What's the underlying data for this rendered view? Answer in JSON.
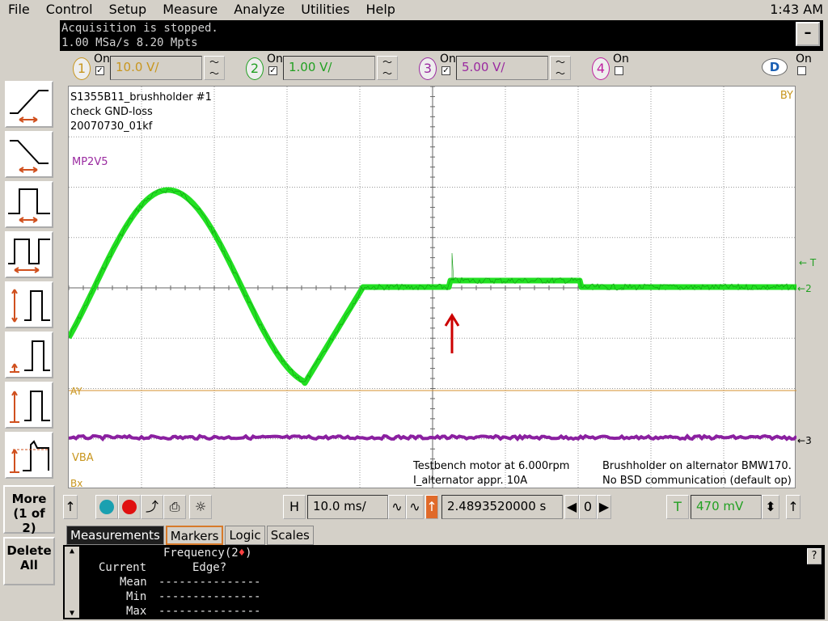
{
  "menu": [
    "File",
    "Control",
    "Setup",
    "Measure",
    "Analyze",
    "Utilities",
    "Help"
  ],
  "clock": "1:43 AM",
  "status": {
    "line1": "Acquisition is stopped.",
    "line2": "1.00 MSa/s   8.20 Mpts"
  },
  "channels": [
    {
      "num": "1",
      "on": "On",
      "checked": true,
      "scale": "10.0 V/",
      "color": "#c8961e",
      "ring": "#c8961e"
    },
    {
      "num": "2",
      "on": "On",
      "checked": true,
      "scale": "1.00 V/",
      "color": "#22a022",
      "ring": "#22a022"
    },
    {
      "num": "3",
      "on": "On",
      "checked": true,
      "scale": "5.00 V/",
      "color": "#9a2aa0",
      "ring": "#9a2aa0"
    },
    {
      "num": "4",
      "on": "On",
      "checked": false,
      "scale": "",
      "color": "#c020a0",
      "ring": "#c020a0"
    },
    {
      "num": "D",
      "on": "On",
      "checked": false,
      "scale": "",
      "color": "#1a5fb4",
      "ring": "#1a5fb4"
    }
  ],
  "side_buttons": {
    "more": "More",
    "more_sub": "(1 of 2)",
    "delete": "Delete",
    "delete_sub": "All"
  },
  "plot": {
    "annot_title1": "S1355B11_brushholder #1",
    "annot_title2": "check GND-loss",
    "annot_title3": "20070730_01kf",
    "label_mp2v5": "MP2V5",
    "label_vba": "VBA",
    "label_by": "BY",
    "label_ay": "AY",
    "label_bx": "Bx",
    "label_t": "T",
    "label_2": "2",
    "label_3": "3",
    "note_left1": "Testbench motor at 6.000rpm",
    "note_left2": "I_alternator appr. 10A",
    "note_right1": "Brushholder on alternator BMW170.",
    "note_right2": "No BSD communication (default op)"
  },
  "timebase": {
    "h_label": "H",
    "h_scale": "10.0 ms/",
    "position": "2.4893520000 s",
    "zero": "0",
    "t_label": "T",
    "trigger_level": "470 mV"
  },
  "tabs": [
    "Measurements",
    "Markers",
    "Logic",
    "Scales"
  ],
  "measurements": {
    "header": "Frequency(2",
    "header_end": ")",
    "current_label": "Current",
    "current_value": "Edge?",
    "mean_label": "Mean",
    "mean_value": "---------------",
    "min_label": "Min",
    "min_value": "---------------",
    "max_label": "Max",
    "max_value": "---------------",
    "help": "?"
  },
  "colors": {
    "trace_green": "#22e022",
    "trace_purple": "#8a1fa0",
    "marker_arrow": "#cc0000",
    "ref_orange": "#d6902e"
  },
  "icons": [
    "rise-time-icon",
    "fall-time-icon",
    "positive-width-icon",
    "period-icon",
    "amplitude-icon",
    "base-icon",
    "top-icon",
    "overshoot-icon"
  ]
}
